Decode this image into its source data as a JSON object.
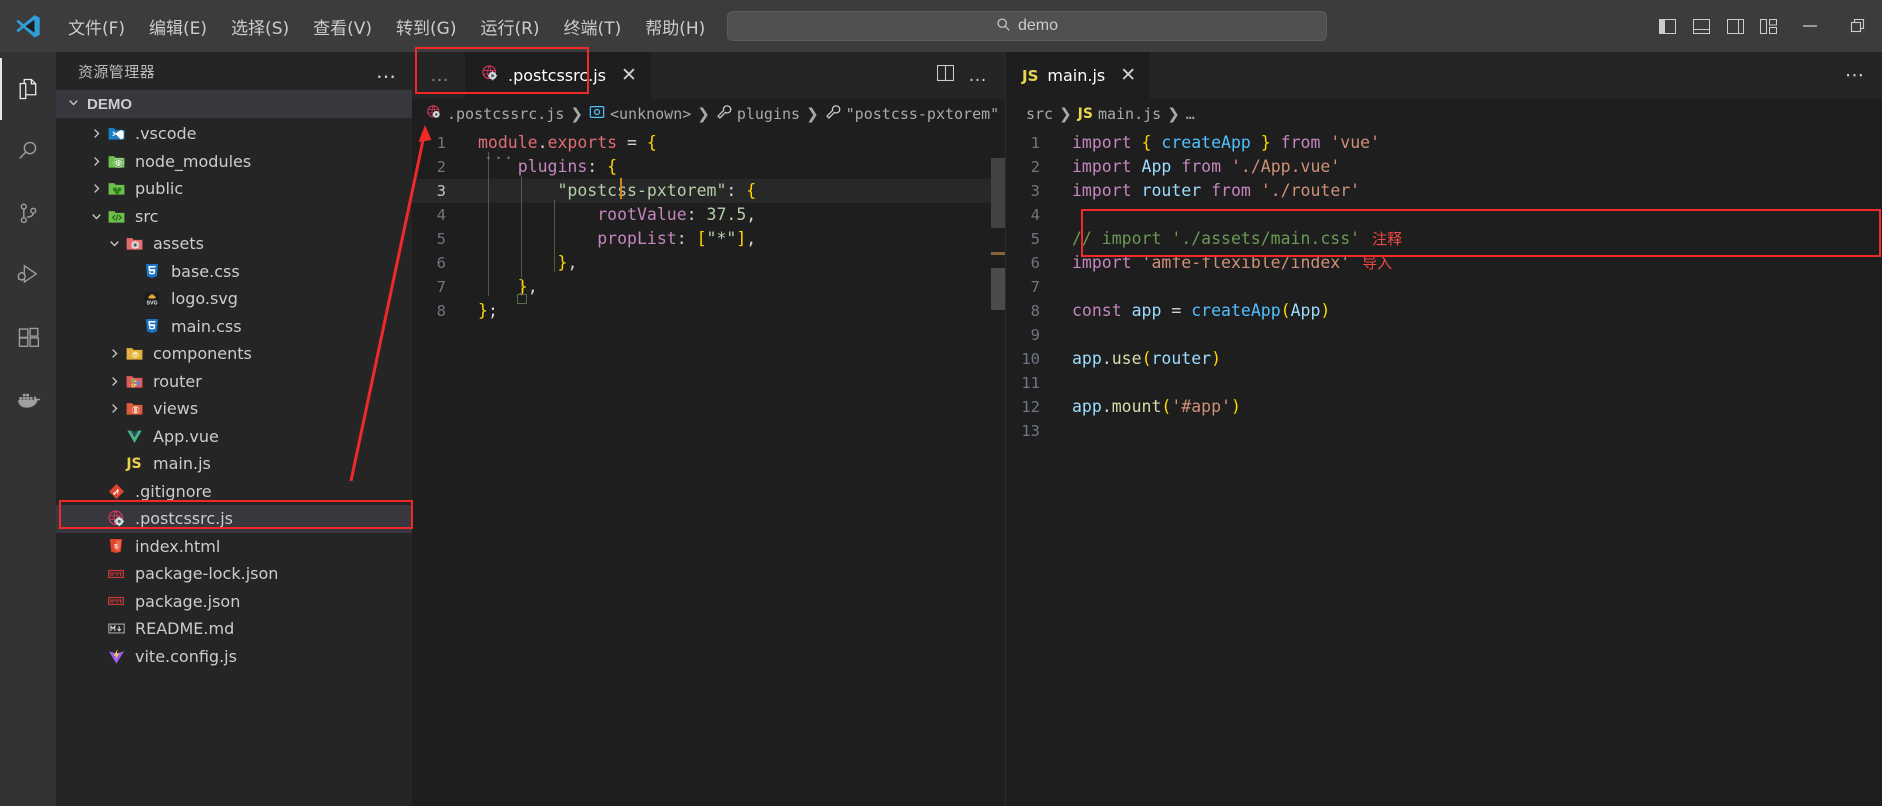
{
  "titlebar": {
    "logo_icon": "vscode-logo-icon",
    "menus": [
      {
        "label": "文件(F)",
        "name": "menu-file"
      },
      {
        "label": "编辑(E)",
        "name": "menu-edit"
      },
      {
        "label": "选择(S)",
        "name": "menu-selection"
      },
      {
        "label": "查看(V)",
        "name": "menu-view"
      },
      {
        "label": "转到(G)",
        "name": "menu-go"
      },
      {
        "label": "运行(R)",
        "name": "menu-run"
      },
      {
        "label": "终端(T)",
        "name": "menu-terminal"
      },
      {
        "label": "帮助(H)",
        "name": "menu-help"
      }
    ],
    "nav": {
      "back": "←",
      "forward": "→"
    },
    "search": {
      "value": "demo",
      "icon": "search-icon"
    },
    "layout_icons": [
      "toggle-primary-sidebar-icon",
      "toggle-panel-icon",
      "toggle-secondary-sidebar-icon",
      "customize-layout-icon"
    ],
    "window_controls": {
      "minimize": "—",
      "restore": "restore-icon"
    }
  },
  "activitybar": {
    "items": [
      {
        "name": "activity-explorer",
        "icon": "files-icon",
        "active": true
      },
      {
        "name": "activity-search",
        "icon": "search-icon",
        "active": false
      },
      {
        "name": "activity-source-control",
        "icon": "source-control-icon",
        "active": false
      },
      {
        "name": "activity-run-debug",
        "icon": "run-debug-icon",
        "active": false
      },
      {
        "name": "activity-extensions",
        "icon": "extensions-icon",
        "active": false
      },
      {
        "name": "activity-docker",
        "icon": "docker-icon",
        "active": false
      }
    ]
  },
  "sidebar": {
    "title": "资源管理器",
    "more_actions": "…",
    "root": {
      "label": "DEMO",
      "expanded": true
    },
    "tree": [
      {
        "label": ".vscode",
        "indent": 1,
        "type": "folder",
        "expanded": false,
        "icon": "folder-vscode-icon"
      },
      {
        "label": "node_modules",
        "indent": 1,
        "type": "folder",
        "expanded": false,
        "icon": "folder-node-icon"
      },
      {
        "label": "public",
        "indent": 1,
        "type": "folder",
        "expanded": false,
        "icon": "folder-public-icon"
      },
      {
        "label": "src",
        "indent": 1,
        "type": "folder",
        "expanded": true,
        "icon": "folder-src-icon"
      },
      {
        "label": "assets",
        "indent": 2,
        "type": "folder",
        "expanded": true,
        "icon": "folder-assets-icon"
      },
      {
        "label": "base.css",
        "indent": 3,
        "type": "file",
        "icon": "css-icon"
      },
      {
        "label": "logo.svg",
        "indent": 3,
        "type": "file",
        "icon": "svg-icon"
      },
      {
        "label": "main.css",
        "indent": 3,
        "type": "file",
        "icon": "css-icon"
      },
      {
        "label": "components",
        "indent": 2,
        "type": "folder",
        "expanded": false,
        "icon": "folder-components-icon"
      },
      {
        "label": "router",
        "indent": 2,
        "type": "folder",
        "expanded": false,
        "icon": "folder-router-icon"
      },
      {
        "label": "views",
        "indent": 2,
        "type": "folder",
        "expanded": false,
        "icon": "folder-views-icon"
      },
      {
        "label": "App.vue",
        "indent": 2,
        "type": "file",
        "icon": "vue-icon"
      },
      {
        "label": "main.js",
        "indent": 2,
        "type": "file",
        "icon": "js-icon"
      },
      {
        "label": ".gitignore",
        "indent": 1,
        "type": "file",
        "icon": "git-icon"
      },
      {
        "label": ".postcssrc.js",
        "indent": 1,
        "type": "file",
        "icon": "postcss-icon",
        "selected": true,
        "annotated": true
      },
      {
        "label": "index.html",
        "indent": 1,
        "type": "file",
        "icon": "html-icon"
      },
      {
        "label": "package-lock.json",
        "indent": 1,
        "type": "file",
        "icon": "npm-icon"
      },
      {
        "label": "package.json",
        "indent": 1,
        "type": "file",
        "icon": "npm-icon"
      },
      {
        "label": "README.md",
        "indent": 1,
        "type": "file",
        "icon": "markdown-icon"
      },
      {
        "label": "vite.config.js",
        "indent": 1,
        "type": "file",
        "icon": "vite-icon"
      }
    ]
  },
  "editor_left": {
    "leading_more": "…",
    "tab": {
      "label": ".postcssrc.js",
      "icon": "postcss-icon",
      "close": "✕",
      "active": true,
      "annotated": true
    },
    "actions": {
      "split_editor": "split-editor-icon",
      "more": "…"
    },
    "breadcrumb": [
      {
        "text": ".postcssrc.js",
        "icon": "postcss-icon"
      },
      {
        "text": "<unknown>",
        "icon": "symbol-object-icon"
      },
      {
        "text": "plugins",
        "icon": "symbol-property-icon"
      },
      {
        "text": "\"postcss-pxtorem\"",
        "icon": "symbol-property-icon"
      }
    ],
    "lines": [
      {
        "n": "1",
        "text": "module.exports = {"
      },
      {
        "n": "2",
        "text": "    plugins: {"
      },
      {
        "n": "3",
        "text": "        \"postcss-pxtorem\": {"
      },
      {
        "n": "4",
        "text": "            rootValue: 37.5,"
      },
      {
        "n": "5",
        "text": "            propList: [\"*\"],"
      },
      {
        "n": "6",
        "text": "        },"
      },
      {
        "n": "7",
        "text": "    },"
      },
      {
        "n": "8",
        "text": "};"
      }
    ],
    "cursor_line": "3"
  },
  "editor_right": {
    "tab": {
      "label": "main.js",
      "icon": "js-icon",
      "close": "✕",
      "active": true
    },
    "more": "⋯",
    "breadcrumb": [
      {
        "text": "src",
        "icon": ""
      },
      {
        "text": "main.js",
        "icon": "js-icon"
      },
      {
        "text": "…",
        "icon": ""
      }
    ],
    "lines": [
      {
        "n": "1",
        "text": "import { createApp } from 'vue'"
      },
      {
        "n": "2",
        "text": "import App from './App.vue'"
      },
      {
        "n": "3",
        "text": "import router from './router'"
      },
      {
        "n": "4",
        "text": ""
      },
      {
        "n": "5",
        "text": "// import './assets/main.css'",
        "note": "注释"
      },
      {
        "n": "6",
        "text": "import 'amfe-flexible/index'",
        "note": "导入"
      },
      {
        "n": "7",
        "text": ""
      },
      {
        "n": "8",
        "text": "const app = createApp(App)"
      },
      {
        "n": "9",
        "text": ""
      },
      {
        "n": "10",
        "text": "app.use(router)"
      },
      {
        "n": "11",
        "text": ""
      },
      {
        "n": "12",
        "text": "app.mount('#app')"
      },
      {
        "n": "13",
        "text": ""
      }
    ],
    "annotation_lines": [
      "5",
      "6"
    ]
  },
  "annotations": {
    "color": "#f02a2a",
    "boxes": [
      "sidebar-postcssrc-row",
      "tab-postcssrc",
      "main-js-lines-5-6"
    ],
    "arrow": "arrow-from-sidebar-to-editor"
  }
}
